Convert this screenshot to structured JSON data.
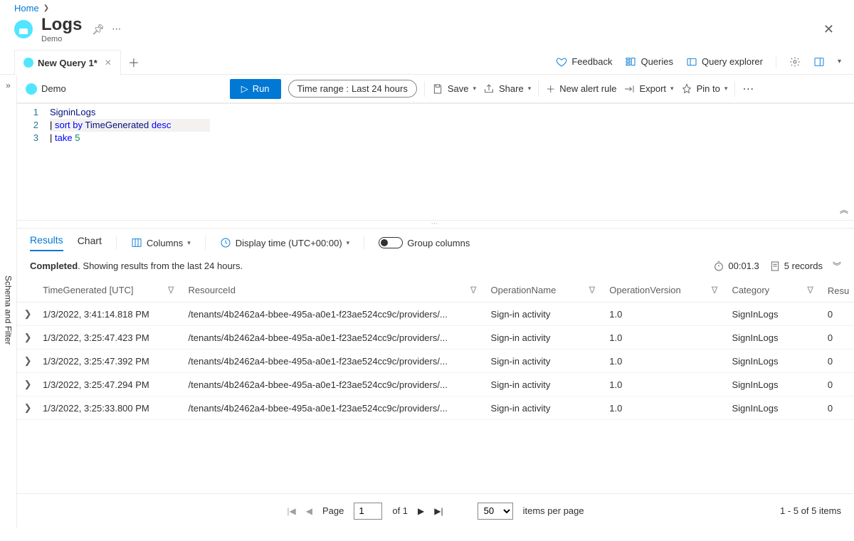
{
  "breadcrumb": {
    "home": "Home"
  },
  "header": {
    "title": "Logs",
    "subtitle": "Demo"
  },
  "tabs": {
    "active_label": "New Query 1*"
  },
  "topRight": {
    "feedback": "Feedback",
    "queries": "Queries",
    "explorer": "Query explorer"
  },
  "actionBar": {
    "scope": "Demo",
    "run": "Run",
    "time_label": "Time range :",
    "time_value": "Last 24 hours",
    "save": "Save",
    "share": "Share",
    "new_alert": "New alert rule",
    "export": "Export",
    "pin": "Pin to"
  },
  "editor": {
    "lines": {
      "n1": "1",
      "n2": "2",
      "n3": "3",
      "l1_token": "SigninLogs",
      "l2_sort": "sort",
      "l2_by": "by",
      "l2_col": "TimeGenerated",
      "l2_desc": "desc",
      "l3_take": "take",
      "l3_num": "5"
    }
  },
  "sideRail": {
    "label": "Schema and Filter"
  },
  "resultsTabs": {
    "results": "Results",
    "chart": "Chart",
    "columns": "Columns",
    "display_time": "Display time (UTC+00:00)",
    "group_cols": "Group columns"
  },
  "status": {
    "completed": "Completed",
    "completed_suffix": ". ",
    "showing": "Showing results from the last 24 hours.",
    "elapsed": "00:01.3",
    "records": "5 records"
  },
  "columns": {
    "time": "TimeGenerated [UTC]",
    "resource": "ResourceId",
    "op": "OperationName",
    "ver": "OperationVersion",
    "cat": "Category",
    "resu": "Resu"
  },
  "rows": [
    {
      "time": "1/3/2022, 3:41:14.818 PM",
      "resource": "/tenants/4b2462a4-bbee-495a-a0e1-f23ae524cc9c/providers/...",
      "op": "Sign-in activity",
      "ver": "1.0",
      "cat": "SignInLogs",
      "resu": "0"
    },
    {
      "time": "1/3/2022, 3:25:47.423 PM",
      "resource": "/tenants/4b2462a4-bbee-495a-a0e1-f23ae524cc9c/providers/...",
      "op": "Sign-in activity",
      "ver": "1.0",
      "cat": "SignInLogs",
      "resu": "0"
    },
    {
      "time": "1/3/2022, 3:25:47.392 PM",
      "resource": "/tenants/4b2462a4-bbee-495a-a0e1-f23ae524cc9c/providers/...",
      "op": "Sign-in activity",
      "ver": "1.0",
      "cat": "SignInLogs",
      "resu": "0"
    },
    {
      "time": "1/3/2022, 3:25:47.294 PM",
      "resource": "/tenants/4b2462a4-bbee-495a-a0e1-f23ae524cc9c/providers/...",
      "op": "Sign-in activity",
      "ver": "1.0",
      "cat": "SignInLogs",
      "resu": "0"
    },
    {
      "time": "1/3/2022, 3:25:33.800 PM",
      "resource": "/tenants/4b2462a4-bbee-495a-a0e1-f23ae524cc9c/providers/...",
      "op": "Sign-in activity",
      "ver": "1.0",
      "cat": "SignInLogs",
      "resu": "0"
    }
  ],
  "pager": {
    "page_label": "Page",
    "page_value": "1",
    "of_label": "of 1",
    "per_page_value": "50",
    "per_page_label": "items per page",
    "summary": "1 - 5 of 5 items"
  }
}
